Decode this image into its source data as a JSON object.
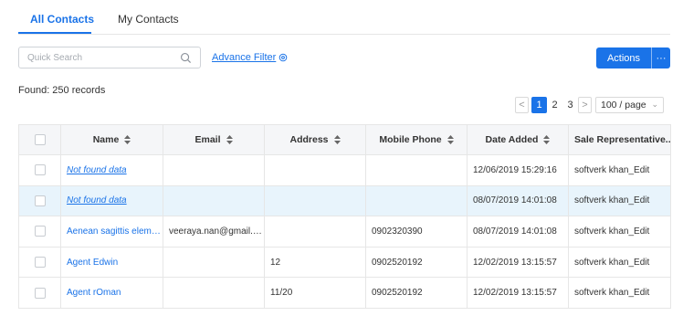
{
  "tabs": [
    {
      "label": "All Contacts",
      "active": true
    },
    {
      "label": "My Contacts",
      "active": false
    }
  ],
  "search": {
    "placeholder": "Quick Search"
  },
  "advance_filter": {
    "label": "Advance Filter",
    "icon": "filter-gear-icon"
  },
  "actions": {
    "label": "Actions",
    "more": "···"
  },
  "found_text": "Found: 250 records",
  "pagination": {
    "prev": "<",
    "next": ">",
    "pages": [
      "1",
      "2",
      "3"
    ],
    "current_page": "1",
    "page_size": "100 / page"
  },
  "table": {
    "columns": [
      "Name",
      "Email",
      "Address",
      "Mobile Phone",
      "Date Added",
      "Sale Representative..."
    ],
    "rows": [
      {
        "name": "Not found data",
        "email": "",
        "address": "",
        "mobile": "",
        "date_added": "12/06/2019 15:29:16",
        "sale_rep": "softverk khan_Edit",
        "selected": false
      },
      {
        "name": "Not found data",
        "email": "",
        "address": "",
        "mobile": "",
        "date_added": "08/07/2019 14:01:08",
        "sale_rep": "softverk khan_Edit",
        "selected": true
      },
      {
        "name": "Aenean sagittis elemen...",
        "email": "veeraya.nan@gmail.com",
        "address": "",
        "mobile": "0902320390",
        "date_added": "08/07/2019 14:01:08",
        "sale_rep": "softverk khan_Edit",
        "selected": false
      },
      {
        "name": "Agent Edwin",
        "email": "",
        "address": "12",
        "mobile": "0902520192",
        "date_added": "12/02/2019 13:15:57",
        "sale_rep": "softverk khan_Edit",
        "selected": false
      },
      {
        "name": "Agent rOman",
        "email": "",
        "address": "11/20",
        "mobile": "0902520192",
        "date_added": "12/02/2019 13:15:57",
        "sale_rep": "softverk khan_Edit",
        "selected": false
      }
    ]
  },
  "colors": {
    "accent": "#1a73e8",
    "header_bg": "#f5f6f8",
    "selected_row_bg": "#e8f4fc",
    "border": "#e6e6e6"
  }
}
